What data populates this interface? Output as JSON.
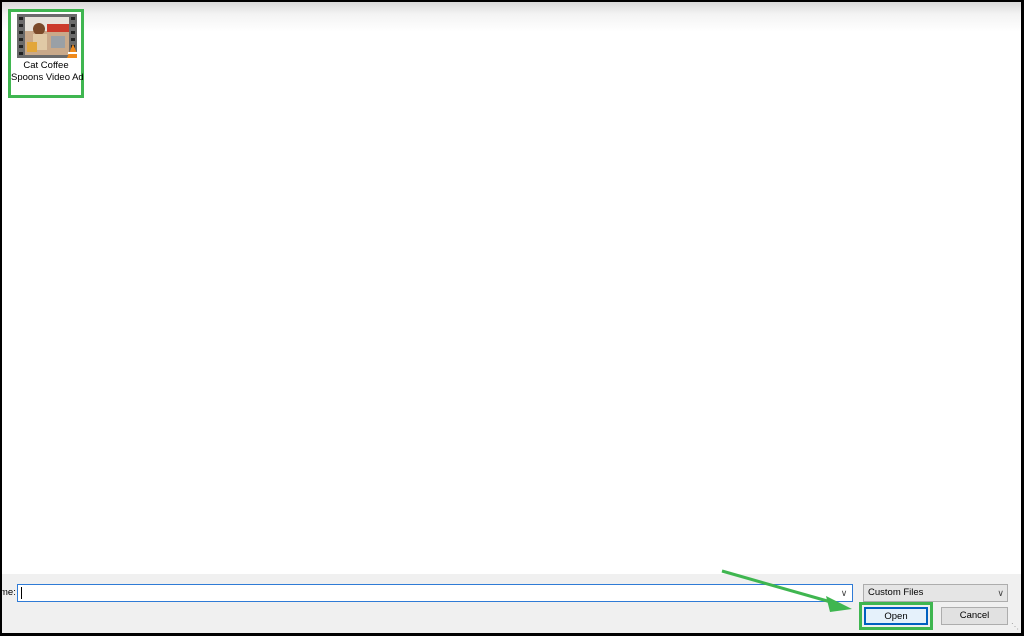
{
  "files": [
    {
      "name_line1": "Cat Coffee",
      "name_line2": "Spoons Video Ad",
      "icon": "video-file-icon"
    }
  ],
  "footer": {
    "filename_label": "me:",
    "filename_value": "",
    "filetype_selected": "Custom Files",
    "open_label": "Open",
    "cancel_label": "Cancel"
  },
  "colors": {
    "highlight": "#3fb650",
    "focus_border": "#0060c0"
  }
}
